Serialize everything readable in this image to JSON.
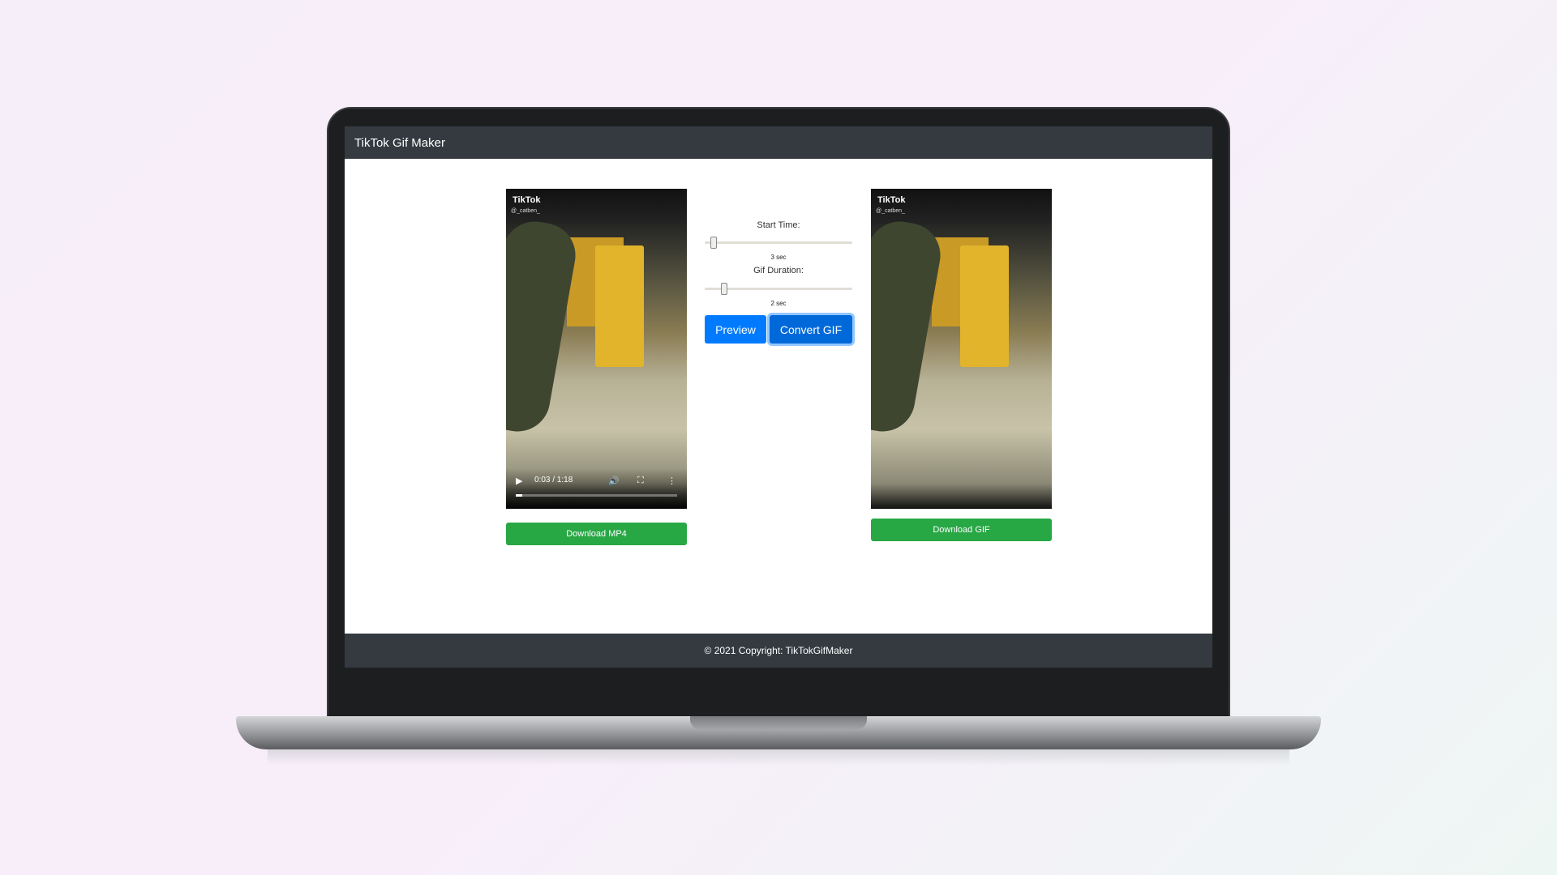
{
  "app": {
    "title": "TikTok Gif Maker"
  },
  "source_video": {
    "watermark": "TikTok",
    "handle": "@_catben_",
    "time": "0:03 / 1:18",
    "progress": 0.04
  },
  "gif_preview": {
    "watermark": "TikTok",
    "handle": "@_catben_"
  },
  "controls": {
    "start_label": "Start Time:",
    "start_value": "3 sec",
    "start_fraction": 0.06,
    "duration_label": "Gif Duration:",
    "duration_value": "2 sec",
    "duration_fraction": 0.13,
    "preview": "Preview",
    "convert": "Convert GIF"
  },
  "buttons": {
    "download_mp4": "Download MP4",
    "download_gif": "Download GIF"
  },
  "footer": {
    "text": "© 2021 Copyright: TikTokGifMaker"
  },
  "colors": {
    "primary": "#007bff",
    "success": "#28a745",
    "nav": "#343a40"
  }
}
